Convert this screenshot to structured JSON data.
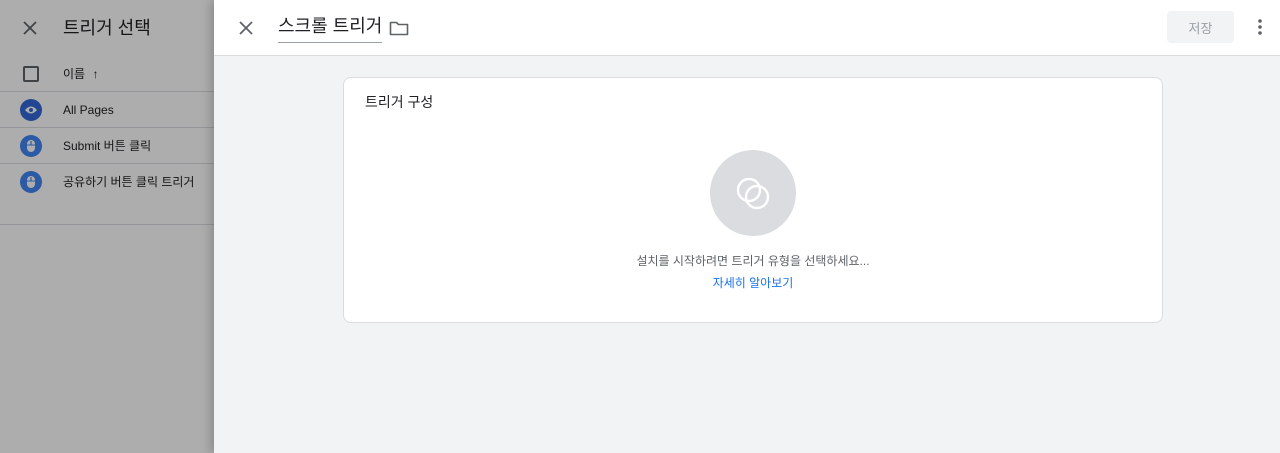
{
  "background_panel": {
    "title": "트리거 선택",
    "column_header": "이름",
    "sort_arrow": "↑",
    "items": [
      {
        "label": "All Pages",
        "icon": "eye-icon"
      },
      {
        "label": "Submit 버튼 클릭",
        "icon": "mouse-icon"
      },
      {
        "label": "공유하기 버튼 클릭 트리거",
        "icon": "mouse-icon"
      }
    ]
  },
  "drawer": {
    "title": "스크롤 트리거",
    "save_label": "저장",
    "card": {
      "title": "트리거 구성",
      "empty_message": "설치를 시작하려면 트리거 유형을 선택하세요...",
      "learn_more": "자세히 알아보기"
    }
  },
  "colors": {
    "accent": "#1a73e8",
    "icon_blue": "#4285f4",
    "panel_bg": "#f1f3f4",
    "scrim": "rgba(0,0,0,0.32)"
  }
}
